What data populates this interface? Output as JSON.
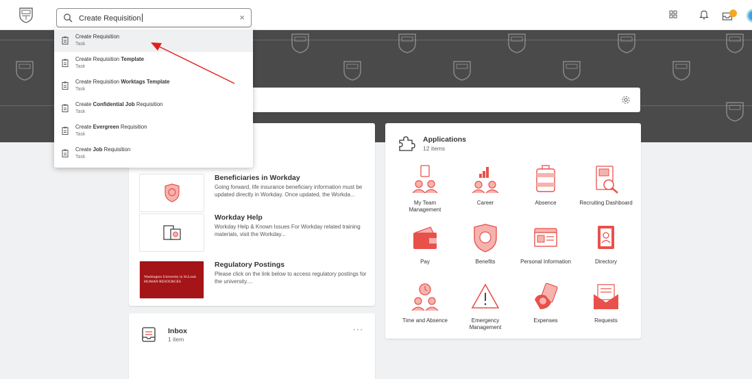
{
  "search": {
    "value": "Create Requisition",
    "clear_label": "×"
  },
  "dropdown": {
    "items": [
      {
        "label_pre": "Create Requisition",
        "label_bold": "",
        "label_post": "",
        "subtitle": "Task"
      },
      {
        "label_pre": "Create Requisition ",
        "label_bold": "Template",
        "label_post": "",
        "subtitle": "Task"
      },
      {
        "label_pre": "Create Requisition ",
        "label_bold": "Worktags Template",
        "label_post": "",
        "subtitle": "Task"
      },
      {
        "label_pre": "Create ",
        "label_bold": "Confidential Job",
        "label_post": " Requisition",
        "subtitle": "Task"
      },
      {
        "label_pre": "Create ",
        "label_bold": "Evergreen",
        "label_post": " Requisition",
        "subtitle": "Task"
      },
      {
        "label_pre": "Create ",
        "label_bold": "Job",
        "label_post": " Requisition",
        "subtitle": "Task"
      }
    ]
  },
  "announcements": [
    {
      "title": "Beneficiaries in Workday",
      "desc": "Going forward, life insurance beneficiary information must be updated directly in Workday.  Once updated, the Workda..."
    },
    {
      "title": "Workday Help",
      "desc": "Workday Help & Known Issues For Workday related training materials, visit the Workday..."
    },
    {
      "title": "Regulatory Postings",
      "desc": "Please click on the link below to access regulatory postings for the university....",
      "thumb_line1": "Washington University in St.Louis",
      "thumb_line2": "HUMAN RESOURCES"
    }
  ],
  "inbox": {
    "title": "Inbox",
    "count": "1 item",
    "more": "···"
  },
  "applications": {
    "title": "Applications",
    "count": "12 items",
    "items": [
      {
        "label": "My Team Management",
        "icon": "team-icon"
      },
      {
        "label": "Career",
        "icon": "career-icon"
      },
      {
        "label": "Absence",
        "icon": "luggage-icon"
      },
      {
        "label": "Recruiting Dashboard",
        "icon": "recruiting-icon"
      },
      {
        "label": "Pay",
        "icon": "wallet-icon"
      },
      {
        "label": "Benefits",
        "icon": "shield-icon"
      },
      {
        "label": "Personal Information",
        "icon": "id-card-icon"
      },
      {
        "label": "Directory",
        "icon": "address-book-icon"
      },
      {
        "label": "Time and Absence",
        "icon": "clock-team-icon"
      },
      {
        "label": "Emergency Management",
        "icon": "warning-icon"
      },
      {
        "label": "Expenses",
        "icon": "expenses-icon"
      },
      {
        "label": "Requests",
        "icon": "envelope-icon"
      }
    ]
  },
  "colors": {
    "accent": "#e8514a",
    "accent_light": "#f6b3ae",
    "hero": "#4a4a4a",
    "wustl_red": "#a51417"
  }
}
